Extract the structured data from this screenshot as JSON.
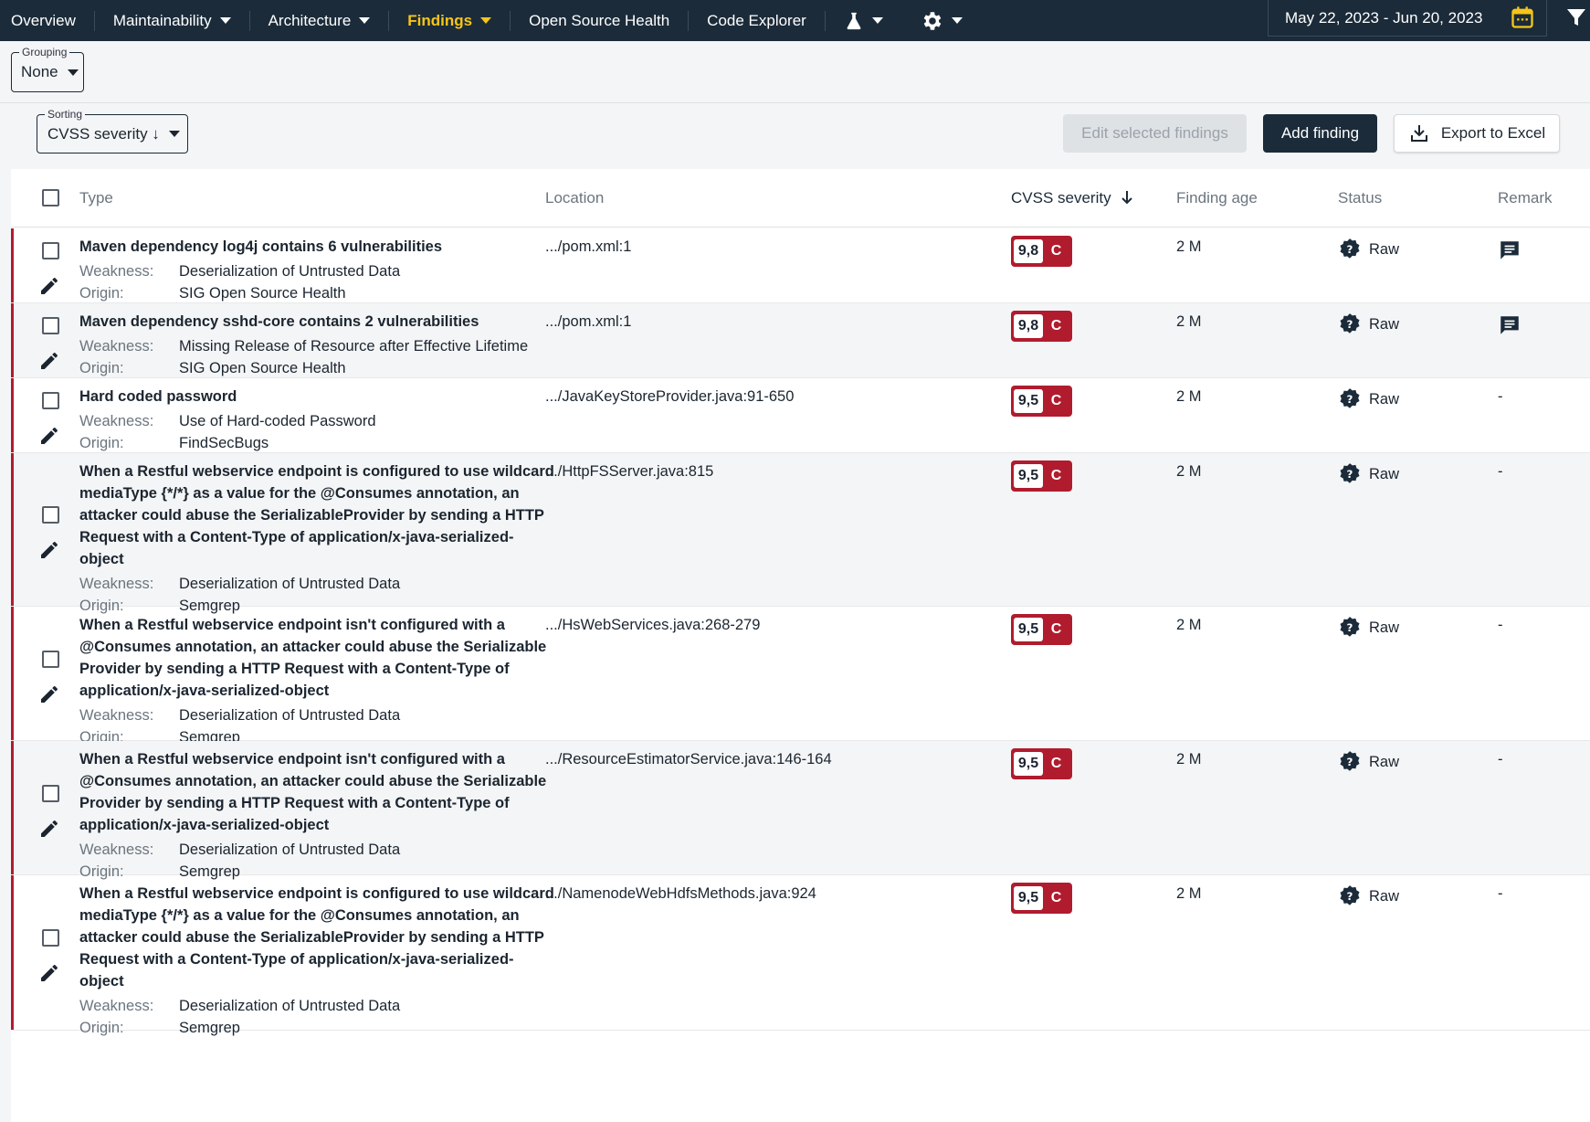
{
  "nav": {
    "items": [
      {
        "label": "Overview",
        "caret": false,
        "active": false
      },
      {
        "label": "Maintainability",
        "caret": true,
        "active": false
      },
      {
        "label": "Architecture",
        "caret": true,
        "active": false
      },
      {
        "label": "Findings",
        "caret": true,
        "active": true
      },
      {
        "label": "Open Source Health",
        "caret": false,
        "active": false
      },
      {
        "label": "Code Explorer",
        "caret": false,
        "active": false
      }
    ],
    "date_range": "May 22, 2023 - Jun 20, 2023",
    "accent_color": "#f5c518"
  },
  "grouping": {
    "legend": "Grouping",
    "value": "None"
  },
  "sorting": {
    "legend": "Sorting",
    "value": "CVSS severity ↓"
  },
  "toolbar": {
    "edit_selected": "Edit selected findings",
    "add_finding": "Add finding",
    "export": "Export to Excel"
  },
  "table": {
    "headers": {
      "type": "Type",
      "location": "Location",
      "severity": "CVSS severity",
      "age": "Finding age",
      "status": "Status",
      "remark": "Remark"
    },
    "weakness_label": "Weakness:",
    "origin_label": "Origin:",
    "severity_color": "#b01c2e",
    "rows": [
      {
        "title": "Maven dependency log4j contains 6 vulnerabilities",
        "weakness": "Deserialization of Untrusted Data",
        "origin": "SIG Open Source Health",
        "location": ".../pom.xml:1",
        "score": "9,8",
        "grade": "C",
        "age": "2 M",
        "status": "Raw",
        "remark": "comment-icon"
      },
      {
        "title": "Maven dependency sshd-core contains 2 vulnerabilities",
        "weakness": "Missing Release of Resource after Effective Lifetime",
        "origin": "SIG Open Source Health",
        "location": ".../pom.xml:1",
        "score": "9,8",
        "grade": "C",
        "age": "2 M",
        "status": "Raw",
        "remark": "comment-icon"
      },
      {
        "title": "Hard coded password",
        "weakness": "Use of Hard-coded Password",
        "origin": "FindSecBugs",
        "location": ".../JavaKeyStoreProvider.java:91-650",
        "score": "9,5",
        "grade": "C",
        "age": "2 M",
        "status": "Raw",
        "remark": "-"
      },
      {
        "title": "When a Restful webservice endpoint is configured to use wildcard mediaType {*/*} as a value for the @Consumes annotation, an attacker could abuse the SerializableProvider by sending a HTTP Request with a Content-Type of application/x-java-serialized-object",
        "weakness": "Deserialization of Untrusted Data",
        "origin": "Semgrep",
        "location": ".../HttpFSServer.java:815",
        "score": "9,5",
        "grade": "C",
        "age": "2 M",
        "status": "Raw",
        "remark": "-"
      },
      {
        "title": "When a Restful webservice endpoint isn't configured with a @Consumes annotation, an attacker could abuse the Serializable Provider by sending a HTTP Request with a Content-Type of application/x-java-serialized-object",
        "weakness": "Deserialization of Untrusted Data",
        "origin": "Semgrep",
        "location": ".../HsWebServices.java:268-279",
        "score": "9,5",
        "grade": "C",
        "age": "2 M",
        "status": "Raw",
        "remark": "-"
      },
      {
        "title": "When a Restful webservice endpoint isn't configured with a @Consumes annotation, an attacker could abuse the Serializable Provider by sending a HTTP Request with a Content-Type of application/x-java-serialized-object",
        "weakness": "Deserialization of Untrusted Data",
        "origin": "Semgrep",
        "location": ".../ResourceEstimatorService.java:146-164",
        "score": "9,5",
        "grade": "C",
        "age": "2 M",
        "status": "Raw",
        "remark": "-"
      },
      {
        "title": "When a Restful webservice endpoint is configured to use wildcard mediaType {*/*} as a value for the @Consumes annotation, an attacker could abuse the SerializableProvider by sending a HTTP Request with a Content-Type of application/x-java-serialized-object",
        "weakness": "Deserialization of Untrusted Data",
        "origin": "Semgrep",
        "location": ".../NamenodeWebHdfsMethods.java:924",
        "score": "9,5",
        "grade": "C",
        "age": "2 M",
        "status": "Raw",
        "remark": "-"
      }
    ]
  }
}
